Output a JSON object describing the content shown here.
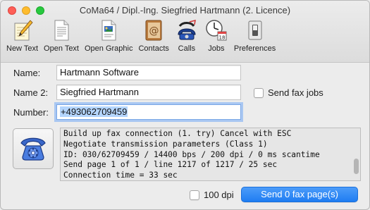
{
  "window": {
    "title": "CoMa64 / Dipl.-Ing. Siegfried Hartmann (2. Licence)"
  },
  "toolbar": {
    "items": [
      {
        "label": "New Text",
        "icon": "pencil-notepad-icon"
      },
      {
        "label": "Open Text",
        "icon": "document-icon"
      },
      {
        "label": "Open Graphic",
        "icon": "graphic-document-icon"
      },
      {
        "label": "Contacts",
        "icon": "address-book-icon"
      },
      {
        "label": "Calls",
        "icon": "telephone-icon"
      },
      {
        "label": "Jobs",
        "icon": "clock-calendar-icon"
      },
      {
        "label": "Preferences",
        "icon": "switch-icon"
      }
    ]
  },
  "form": {
    "name_label": "Name:",
    "name_value": "Hartmann Software",
    "name2_label": "Name 2:",
    "name2_value": "Siegfried Hartmann",
    "number_label": "Number:",
    "number_value": "+493062709459",
    "send_fax_jobs_label": "Send fax jobs"
  },
  "log": {
    "lines": [
      "Build up fax connection (1. try)  Cancel with ESC",
      "Negotiate transmission parameters (Class 1)",
      "ID: 030/62709459 / 14400 bps / 200 dpi / 0 ms scantime",
      "Send page 1 of 1 / line 1217 of 1217 / 25 sec",
      "Connection time = 33 sec"
    ]
  },
  "footer": {
    "dpi_label": "100 dpi",
    "send_button_label": "Send 0 fax page(s)"
  },
  "colors": {
    "accent": "#1f7df2",
    "focus_ring": "#a9c7f2",
    "selection": "#b4d5fd"
  }
}
